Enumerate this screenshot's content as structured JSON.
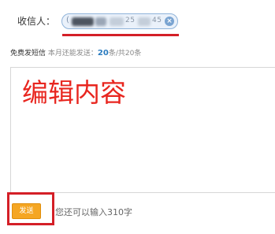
{
  "recipient": {
    "label": "收信人：",
    "chip": {
      "open_char": "(",
      "visible_digits_1": "25",
      "visible_digits_2": "45",
      "close_icon": "close-circle-icon"
    }
  },
  "sms_info": {
    "free_label": "免费发短信",
    "month_label": "本月还能发送：",
    "remaining_count": "20",
    "total_label": "条/共20条"
  },
  "editor": {
    "content": "编辑内容"
  },
  "footer": {
    "send_label": "发送",
    "remaining_chars": "您还可以输入310字"
  },
  "colors": {
    "annotation_red": "#d41f27",
    "editor_text_red": "#e8261f",
    "send_orange": "#f5a623",
    "count_blue": "#2a7bbf",
    "chip_bg": "#eaf1fa"
  }
}
